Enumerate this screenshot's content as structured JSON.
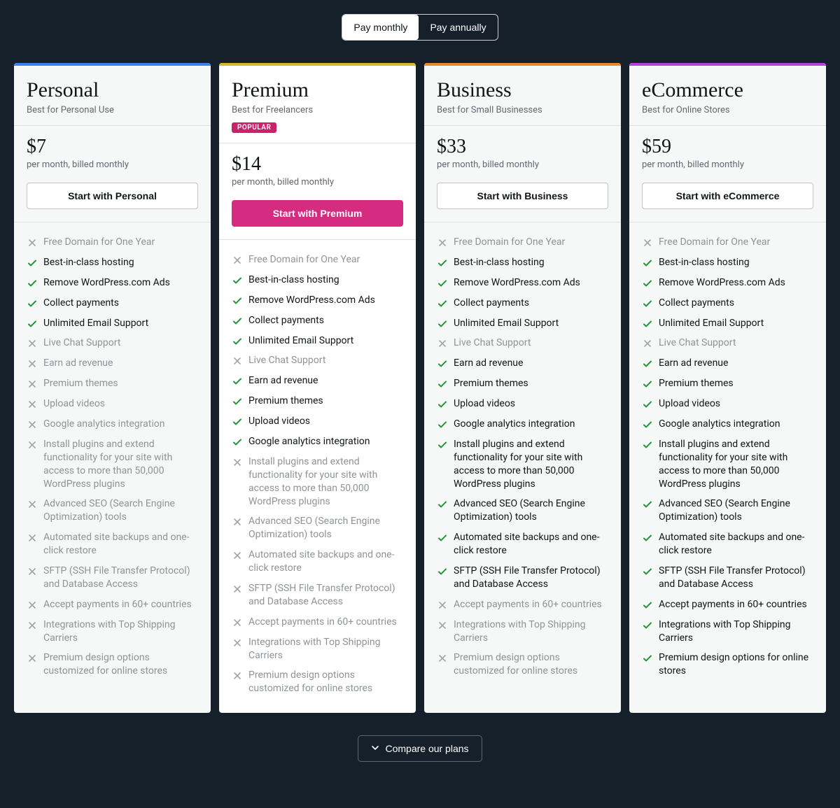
{
  "toggle": {
    "monthly": "Pay monthly",
    "annually": "Pay annually",
    "active": "monthly"
  },
  "features": [
    "Free Domain for One Year",
    "Best-in-class hosting",
    "Remove WordPress.com Ads",
    "Collect payments",
    "Unlimited Email Support",
    "Live Chat Support",
    "Earn ad revenue",
    "Premium themes",
    "Upload videos",
    "Google analytics integration",
    "Install plugins and extend functionality for your site with access to more than 50,000 WordPress plugins",
    "Advanced SEO (Search Engine Optimization) tools",
    "Automated site backups and one-click restore",
    "SFTP (SSH File Transfer Protocol) and Database Access",
    "Accept payments in 60+ countries",
    "Integrations with Top Shipping Carriers",
    "Premium design options customized for online stores"
  ],
  "plans": [
    {
      "id": "personal",
      "name": "Personal",
      "tagline": "Best for Personal Use",
      "price": "$7",
      "billing": "per month, billed monthly",
      "cta": "Start with Personal",
      "highlight": false,
      "badge": null,
      "barColor": "#3f80ea",
      "included": [
        false,
        true,
        true,
        true,
        true,
        false,
        false,
        false,
        false,
        false,
        false,
        false,
        false,
        false,
        false,
        false,
        false
      ]
    },
    {
      "id": "premium",
      "name": "Premium",
      "tagline": "Best for Freelancers",
      "price": "$14",
      "billing": "per month, billed monthly",
      "cta": "Start with Premium",
      "highlight": true,
      "badge": "POPULAR",
      "barColor": "#d6b92a",
      "included": [
        false,
        true,
        true,
        true,
        true,
        false,
        true,
        true,
        true,
        true,
        false,
        false,
        false,
        false,
        false,
        false,
        false
      ]
    },
    {
      "id": "business",
      "name": "Business",
      "tagline": "Best for Small Businesses",
      "price": "$33",
      "billing": "per month, billed monthly",
      "cta": "Start with Business",
      "highlight": false,
      "badge": null,
      "barColor": "#e6892f",
      "included": [
        false,
        true,
        true,
        true,
        true,
        false,
        true,
        true,
        true,
        true,
        true,
        true,
        true,
        true,
        false,
        false,
        false
      ]
    },
    {
      "id": "ecommerce",
      "name": "eCommerce",
      "tagline": "Best for Online Stores",
      "price": "$59",
      "billing": "per month, billed monthly",
      "cta": "Start with eCommerce",
      "highlight": false,
      "badge": null,
      "barColor": "#b244d6",
      "included": [
        false,
        true,
        true,
        true,
        true,
        false,
        true,
        true,
        true,
        true,
        true,
        true,
        true,
        true,
        true,
        true,
        true
      ],
      "featureOverrides": {
        "16": "Premium design options for online stores"
      }
    }
  ],
  "compare": "Compare our plans"
}
